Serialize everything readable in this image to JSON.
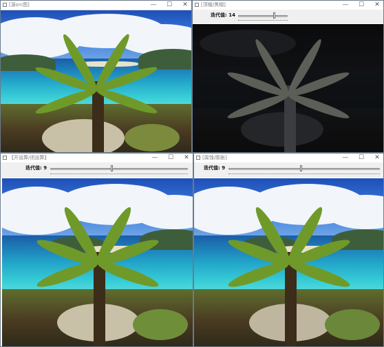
{
  "windows": [
    {
      "title": "[源src图]",
      "controls": [
        "—",
        "☐",
        "✕"
      ],
      "has_trackbar": false
    },
    {
      "title": "[顶帽/黑帽]",
      "controls": [
        "—",
        "☐",
        "✕"
      ],
      "has_trackbar": true,
      "trackbar": {
        "label": "迭代值: 14",
        "position": 0.73
      }
    },
    {
      "title": "【开运算/闭运算】",
      "controls": [
        "—",
        "☐",
        "✕"
      ],
      "has_trackbar": true,
      "trackbar": {
        "label": "迭代值: 9",
        "position": 0.45
      }
    },
    {
      "title": "[腐蚀/膨胀]",
      "controls": [
        "—",
        "☐",
        "✕"
      ],
      "has_trackbar": true,
      "trackbar": {
        "label": "迭代值: 9",
        "position": 0.45
      }
    }
  ],
  "colors": {
    "frame": "#6b7b8c",
    "titlebar": "#ffffff",
    "trackbar_bg": "#f0f0f0"
  },
  "icons": [
    "window-icon",
    "minimize-icon",
    "maximize-icon",
    "close-icon",
    "trackbar-thumb"
  ]
}
